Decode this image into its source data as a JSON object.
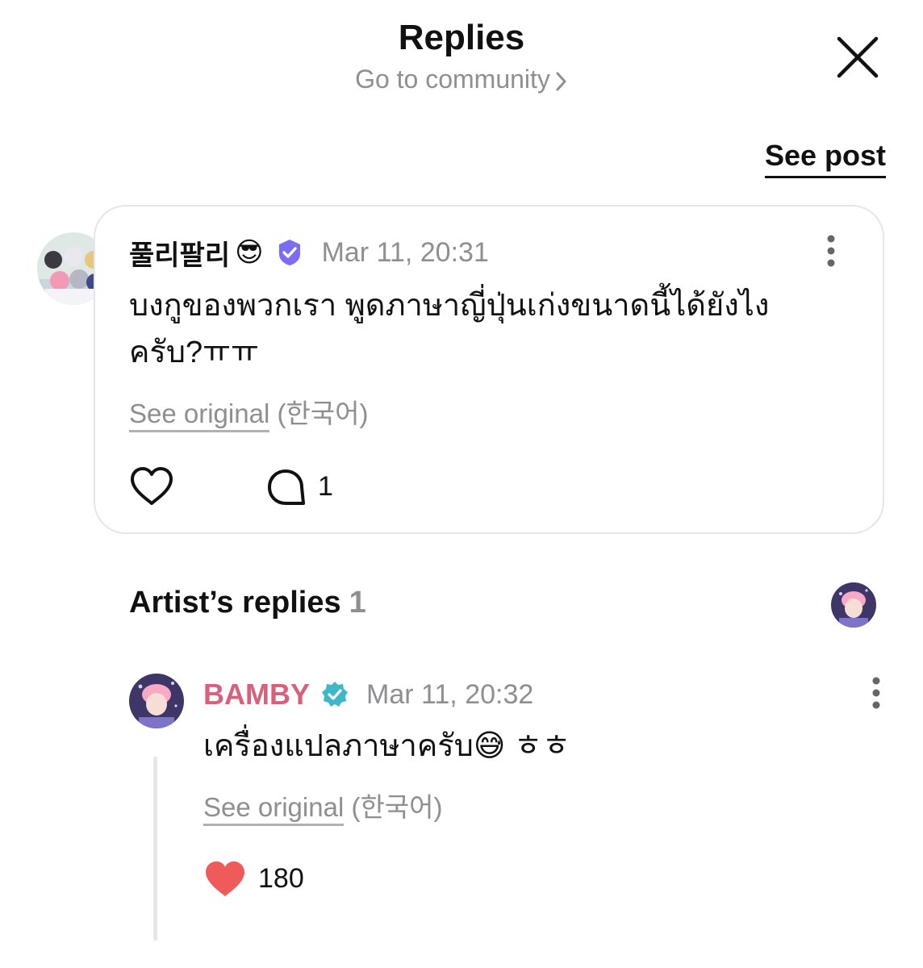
{
  "header": {
    "title": "Replies",
    "community_link": "Go to community",
    "see_post": "See post"
  },
  "comment": {
    "username": "풀리팔리",
    "username_emoji": "😎",
    "timestamp": "Mar 11, 20:31",
    "text_line1": "บงกูของพวกเรา พูดภาษาญี่ปุ่นเก่งขนาดนี้ได้ยังไง",
    "text_line2": "ครับ?ㅠㅠ",
    "see_original": "See original",
    "language": "(한국어)",
    "reply_count": "1"
  },
  "artist_replies": {
    "title": "Artist’s replies",
    "count": "1",
    "reply": {
      "username": "BAMBY",
      "timestamp": "Mar 11, 20:32",
      "text": "เครื่องแปลภาษาครับ",
      "text_emoji": "😅",
      "text_suffix": "ㅎㅎ",
      "see_original": "See original",
      "language": "(한국어)",
      "like_count": "180"
    }
  },
  "colors": {
    "accent_pink": "#d9607b",
    "verified_purple": "#7b6cf6",
    "verified_teal": "#3fb7c9",
    "heart_red": "#ef5a5a",
    "muted_gray": "#8e8e93"
  },
  "icons": [
    "close-icon",
    "chevron-right-icon",
    "verified-badge-icon",
    "more-vertical-icon",
    "heart-outline-icon",
    "comment-bubble-icon",
    "heart-filled-icon"
  ]
}
